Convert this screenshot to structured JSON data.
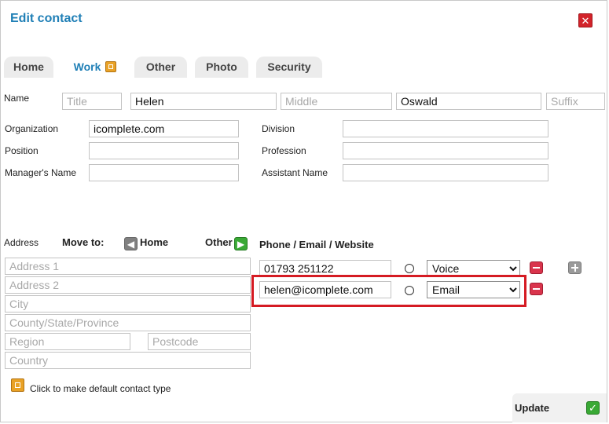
{
  "dialog": {
    "title": "Edit contact",
    "close_icon": "close-icon"
  },
  "tabs": [
    {
      "label": "Home",
      "active": false
    },
    {
      "label": "Work",
      "active": true,
      "icon": "edit-icon"
    },
    {
      "label": "Other",
      "active": false
    },
    {
      "label": "Photo",
      "active": false
    },
    {
      "label": "Security",
      "active": false
    }
  ],
  "name": {
    "label": "Name",
    "title_placeholder": "Title",
    "first": "Helen",
    "middle_placeholder": "Middle",
    "last": "Oswald",
    "suffix_placeholder": "Suffix"
  },
  "work": {
    "organization_label": "Organization",
    "organization": "icomplete.com",
    "division_label": "Division",
    "division": "",
    "position_label": "Position",
    "position": "",
    "profession_label": "Profession",
    "profession": "",
    "manager_label": "Manager's Name",
    "manager": "",
    "assistant_label": "Assistant Name",
    "assistant": ""
  },
  "address": {
    "label": "Address",
    "move_to_label": "Move to:",
    "move_home_label": "Home",
    "move_other_label": "Other",
    "address1_placeholder": "Address 1",
    "address2_placeholder": "Address 2",
    "city_placeholder": "City",
    "county_placeholder": "County/State/Province",
    "region_placeholder": "Region",
    "postcode_placeholder": "Postcode",
    "country_placeholder": "Country"
  },
  "contacts": {
    "header": "Phone / Email / Website",
    "rows": [
      {
        "value": "01793 251122",
        "type": "Voice"
      },
      {
        "value": "helen@icomplete.com",
        "type": "Email"
      }
    ]
  },
  "footer": {
    "default_hint": "Click to make default contact type",
    "update_label": "Update"
  },
  "colors": {
    "title": "#1f7fb6",
    "highlight": "#d51b23",
    "close": "#d2232a",
    "remove": "#d9344c",
    "confirm": "#39a935"
  }
}
